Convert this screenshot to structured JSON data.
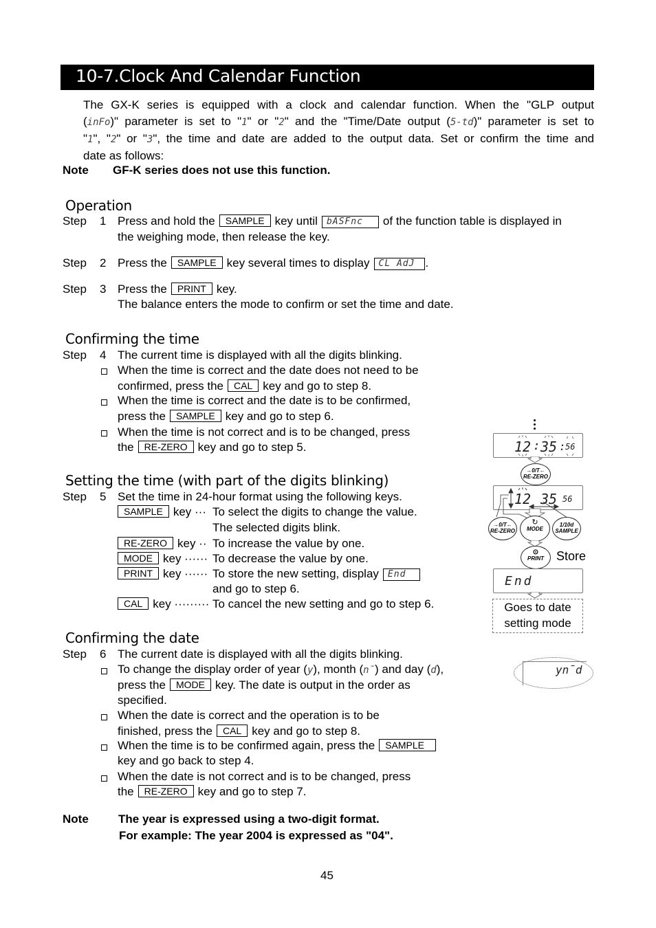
{
  "header": {
    "title": "10-7.Clock And Calendar Function"
  },
  "intro": {
    "line1": "The GX-K series is equipped with a clock and calendar function. When the \"GLP output",
    "line2_a": "(",
    "info_code": "inFo",
    "line2_b": ")\" parameter is set to \"",
    "val1": "1",
    "line2_c": "\" or \"",
    "val2": "2",
    "line2_d": "\" and the \"Time/Date output (",
    "std_code": "5-td",
    "line2_e": ")\" parameter is set to",
    "line3_a": "\"",
    "line3_v1": "1",
    "line3_b": "\", \"",
    "line3_v2": "2",
    "line3_c": "\" or \"",
    "line3_v3": "3",
    "line3_d": "\", the time and date are added to the output data. Set or confirm the time and",
    "line4": "date as follows:",
    "note_label": "Note",
    "note_text": "GF-K series does not use this function."
  },
  "operation": {
    "heading": "Operation",
    "step_word": "Step",
    "step1": {
      "num": "1",
      "a": "Press and hold the",
      "key": "SAMPLE",
      "b": "key until",
      "lcd": "bASFnc",
      "c": "of the function table is displayed in",
      "d": "the weighing mode, then release the key."
    },
    "step2": {
      "num": "2",
      "a": "Press the",
      "key": "SAMPLE",
      "b": "key several times to display",
      "lcd": "CL AdJ",
      "c": "."
    },
    "step3": {
      "num": "3",
      "a": "Press the",
      "key": "PRINT",
      "b": "key.",
      "c": "The balance enters the mode to confirm or set the time and date."
    }
  },
  "confirm_time": {
    "heading": "Confirming the time",
    "step_word": "Step",
    "num": "4",
    "text": "The current time is displayed with all the digits blinking.",
    "b1": {
      "a": "When the time is correct and the date does not need to be",
      "b": "confirmed, press the",
      "key": "CAL",
      "c": "key and go to step 8."
    },
    "b2": {
      "a": "When the time is correct and the date is to be confirmed,",
      "b": "press the",
      "key": "SAMPLE",
      "c": "key and go to step 6."
    },
    "b3": {
      "a": "When the time is not correct and is to be changed, press",
      "b": "the",
      "key": "RE-ZERO",
      "c": "key and go to step 5."
    }
  },
  "set_time": {
    "heading": "Setting the time (with part of the digits blinking)",
    "step_word": "Step",
    "num": "5",
    "text": "Set the time in 24-hour format using the following keys.",
    "keys": [
      {
        "key": "SAMPLE",
        "lead": "key ···",
        "desc": "To select the digits to change the value.",
        "desc2": "The selected digits blink."
      },
      {
        "key": "RE-ZERO",
        "lead": "key ··",
        "desc": "To increase the value by one."
      },
      {
        "key": "MODE",
        "lead": "key ······",
        "desc": "To decrease the value by one."
      },
      {
        "key": "PRINT",
        "lead": "key ······",
        "desc": "To store the new setting, display",
        "lcd": "End",
        "desc2": "and go to step 6."
      },
      {
        "key": "CAL",
        "lead": "key ·········",
        "desc": "To cancel the new setting and go to step 6."
      }
    ]
  },
  "confirm_date": {
    "heading": "Confirming the date",
    "step_word": "Step",
    "num": "6",
    "text": "The current date is displayed with all the digits blinking.",
    "b1": {
      "a": "To change the display order of year (",
      "y": "y",
      "b": "), month (",
      "m": "n̄",
      "c": ") and day (",
      "d": "d",
      "e": "),",
      "f": "press the",
      "key": "MODE",
      "g": "key. The date is output in the order as",
      "h": "specified."
    },
    "b2": {
      "a": "When the date is correct and the operation is to be",
      "b": "finished, press the",
      "key": "CAL",
      "c": "key and go to step 8."
    },
    "b3": {
      "a": "When the time is to be confirmed again, press the",
      "key": "SAMPLE",
      "b": "key and go back to step 4."
    },
    "b4": {
      "a": "When the date is not correct and is to be changed, press",
      "b": "the",
      "key": "RE-ZERO",
      "c": "key and go to step 7."
    },
    "note_label": "Note",
    "note1": "The year is expressed using a two-digit format.",
    "note2": "For example: The year 2004 is expressed as \"04\"."
  },
  "diagram": {
    "lcd1": {
      "hh": "12",
      "mm": "35",
      "ss": "56"
    },
    "lcd2": {
      "hh": "12",
      "mm": "35",
      "ss": "56"
    },
    "lcd3": "End",
    "btn_rezero_sym": "→0/T←",
    "btn_rezero": "RE-ZERO",
    "btn_mode": "MODE",
    "btn_sample_sym": "1/10d",
    "btn_sample": "SAMPLE",
    "btn_print": "PRINT",
    "store_label": "Store",
    "goes_to_1": "Goes to date",
    "goes_to_2": "setting mode",
    "ymd_lcd": "yn̄d"
  },
  "footer": {
    "page_number": "45"
  }
}
